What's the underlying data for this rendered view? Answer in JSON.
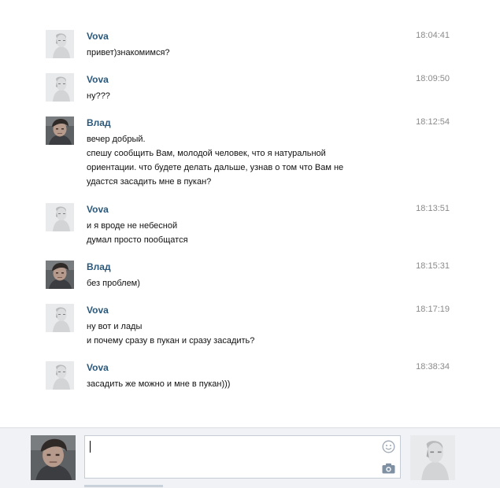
{
  "messages": [
    {
      "author": "Vova",
      "time": "18:04:41",
      "lines": [
        "привет)знакомимся?"
      ],
      "avatar": "vova-avatar"
    },
    {
      "author": "Vova",
      "time": "18:09:50",
      "lines": [
        "ну???"
      ],
      "avatar": "vova-avatar"
    },
    {
      "author": "Влад",
      "time": "18:12:54",
      "lines": [
        "вечер добрый.",
        "спешу сообщить Вам, молодой человек, что я натуральной",
        "ориентации. что будете делать дальше, узнав о том что Вам не",
        "удастся засадить мне в пукан?"
      ],
      "avatar": "vlad-avatar"
    },
    {
      "author": "Vova",
      "time": "18:13:51",
      "lines": [
        "и я вроде не небесной",
        "думал просто пообщатся"
      ],
      "avatar": "vova-avatar"
    },
    {
      "author": "Влад",
      "time": "18:15:31",
      "lines": [
        "без проблем)"
      ],
      "avatar": "vlad-avatar"
    },
    {
      "author": "Vova",
      "time": "18:17:19",
      "lines": [
        "ну вот и лады",
        "и почему сразу в пукан и сразу засадить?"
      ],
      "avatar": "vova-avatar"
    },
    {
      "author": "Vova",
      "time": "18:38:34",
      "lines": [
        "засадить же можно и мне в пукан)))"
      ],
      "avatar": "vova-avatar"
    }
  ],
  "composer": {
    "input_value": "",
    "icons": [
      "smiley-icon",
      "camera-icon"
    ],
    "my_avatar": "vlad-avatar",
    "peer_avatar": "vova-avatar"
  },
  "colors": {
    "author": "#2b587a",
    "time": "#8a8a8a",
    "composer_bg": "#f0f2f5"
  }
}
